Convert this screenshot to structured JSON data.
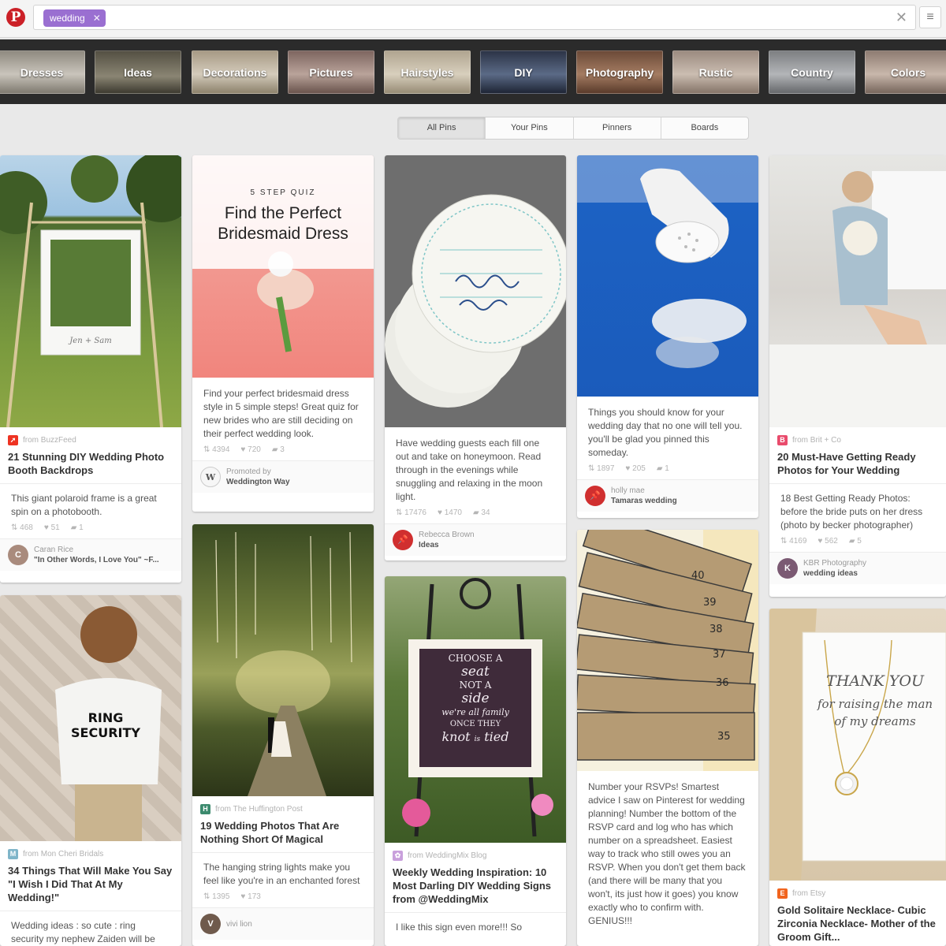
{
  "search": {
    "token": "wedding"
  },
  "categories": [
    "Dresses",
    "Ideas",
    "Decorations",
    "Pictures",
    "Hairstyles",
    "DIY",
    "Photography",
    "Rustic",
    "Country",
    "Colors"
  ],
  "tabs": [
    "All Pins",
    "Your Pins",
    "Pinners",
    "Boards"
  ],
  "pins": {
    "photobooth": {
      "source": "from BuzzFeed",
      "title": "21 Stunning DIY Wedding Photo Booth Backdrops",
      "description": "This giant polaroid frame is a great spin on a photobooth.",
      "repins": "468",
      "likes": "51",
      "comments": "1",
      "pinner": "Caran Rice",
      "board": "\"In Other Words, I Love You\" ~F..."
    },
    "quiz": {
      "kicker": "5 STEP QUIZ",
      "title": "Find the Perfect Bridesmaid Dress",
      "description": "Find your perfect bridesmaid dress style in 5 simple steps! Great quiz for new brides who are still deciding on their perfect wedding look.",
      "repins": "4394",
      "likes": "720",
      "comments": "3",
      "promoted": "Promoted by",
      "promoter": "Weddington Way"
    },
    "coasters": {
      "description": "Have wedding guests each fill one out and take on honeymoon. Read through in the evenings while snuggling and relaxing in the moon light.",
      "repins": "17476",
      "likes": "1470",
      "comments": "34",
      "pinner": "Rebecca Brown",
      "board": "Ideas"
    },
    "powder": {
      "description": "Things you should know for your wedding day that no one will tell you. you'll be glad you pinned this someday.",
      "repins": "1897",
      "likes": "205",
      "comments": "1",
      "pinner": "holly mae",
      "board": "Tamaras wedding"
    },
    "getting_ready": {
      "source": "from Brit + Co",
      "title": "20 Must-Have Getting Ready Photos for Your Wedding",
      "description": "18 Best Getting Ready Photos: before the bride puts on her dress (photo by becker photographer)",
      "repins": "4169",
      "likes": "562",
      "comments": "5",
      "pinner": "KBR Photography",
      "board": "wedding ideas"
    },
    "ring_security": {
      "source": "from Mon Cheri Bridals",
      "title": "34 Things That Will Make You Say \"I Wish I Did That At My Wedding!\"",
      "description": "Wedding ideas : so cute : ring security my nephew Zaiden will be",
      "shirt_text": "RING SECURITY"
    },
    "lights": {
      "source": "from The Huffington Post",
      "title": "19 Wedding Photos That Are Nothing Short Of Magical",
      "description": "The hanging string lights make you feel like you're in an enchanted forest",
      "repins": "1395",
      "likes": "173",
      "pinner": "vivi lion"
    },
    "sign": {
      "source": "from WeddingMix Blog",
      "title": "Weekly Wedding Inspiration: 10 Most Darling DIY Wedding Signs from @WeddingMix",
      "description": "I like this sign even more!!! So",
      "sign_lines": [
        "CHOOSE A",
        "seat",
        "NOT A",
        "side",
        "we're all family",
        "ONCE THEY",
        "knot",
        "is",
        "tied"
      ]
    },
    "rsvp": {
      "description": "Number your RSVPs! Smartest advice I saw on Pinterest for wedding planning! Number the bottom of the RSVP card and log who has which number on a spreadsheet. Easiest way to track who still owes you an RSVP. When you don't get them back (and there will be many that you won't, its just how it goes) you know exactly who to confirm with. GENIUS!!!",
      "card_numbers": [
        "40",
        "39",
        "38",
        "37",
        "36",
        "35"
      ]
    },
    "necklace": {
      "source": "from Etsy",
      "title": "Gold Solitaire Necklace- Cubic Zirconia Necklace- Mother of the Groom Gift...",
      "card_lines": [
        "THANK YOU",
        "for raising the man",
        "of my dreams"
      ]
    }
  },
  "colors": {
    "brand": "#cb2027",
    "token": "#9a6fd1",
    "strip": "#2b2b2b"
  }
}
